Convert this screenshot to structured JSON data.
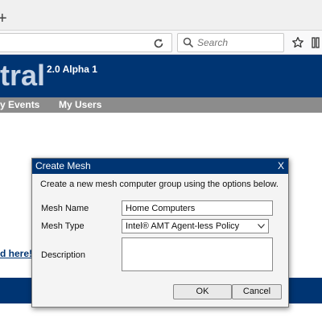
{
  "browser": {
    "new_tab_glyph": "+",
    "search_placeholder": "Search"
  },
  "app": {
    "brand_partial": "tral",
    "version": "2.0 Alpha 1"
  },
  "nav": {
    "items": [
      "y Events",
      "My Users"
    ]
  },
  "page": {
    "link_partial": "d here!"
  },
  "dialog": {
    "title": "Create Mesh",
    "close": "X",
    "intro": "Create a new mesh computer group using the options below.",
    "mesh_name_label": "Mesh Name",
    "mesh_name_value": "Home Computers",
    "mesh_type_label": "Mesh Type",
    "mesh_type_value": "Intel® AMT Agent-less Policy",
    "description_label": "Description",
    "ok_label": "OK",
    "cancel_label": "Cancel"
  },
  "colors": {
    "header_blue": "#003573",
    "nav_gray": "#8c8c8c",
    "dialog_bg": "#f4f4f4"
  }
}
